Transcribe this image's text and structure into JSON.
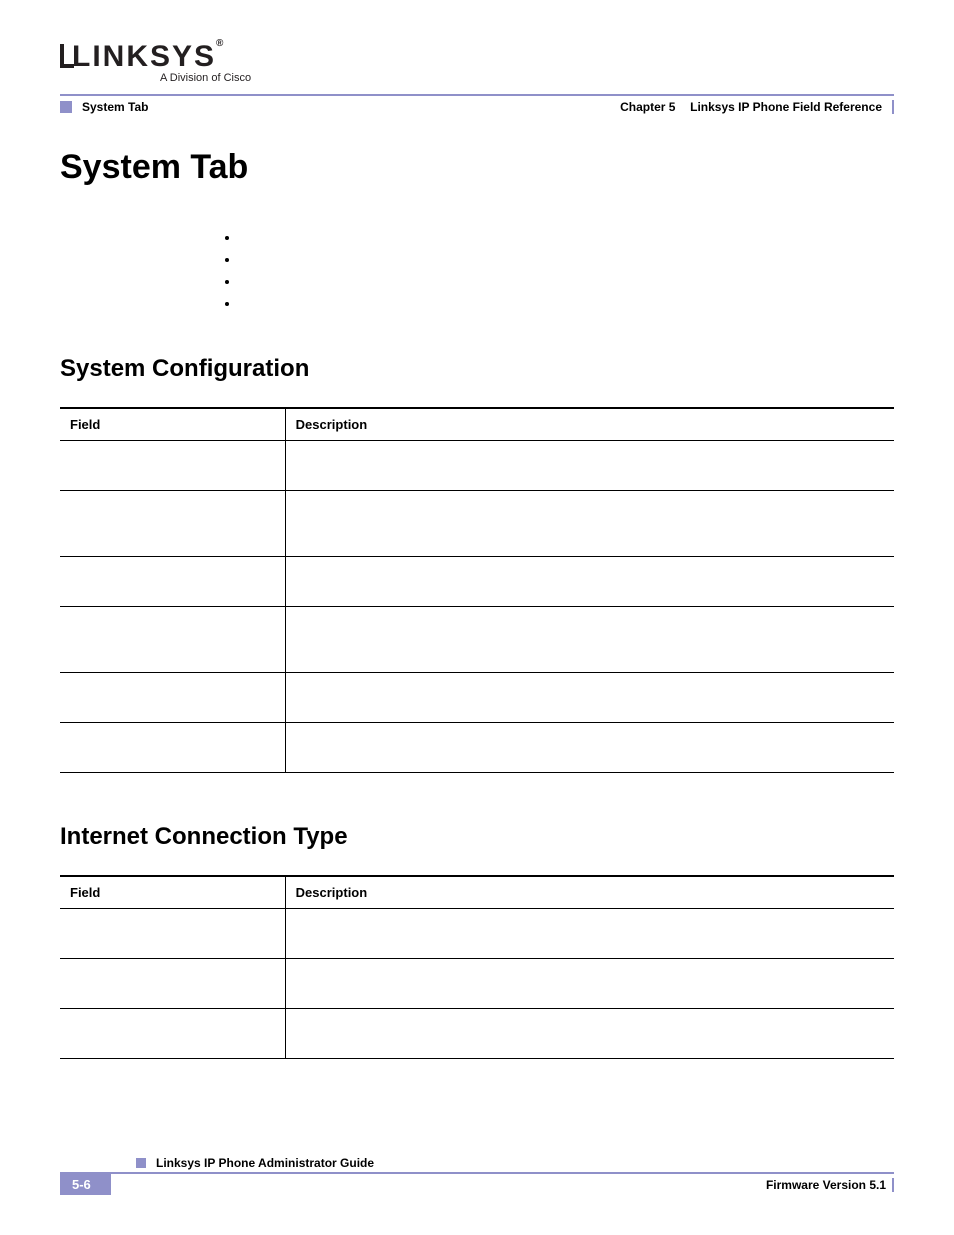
{
  "logo": {
    "brand": "LINKSYS",
    "registered": "®",
    "tagline": "A Division of Cisco"
  },
  "header": {
    "breadcrumb": "System Tab",
    "chapter_label": "Chapter 5",
    "chapter_title": "Linksys IP Phone Field Reference"
  },
  "h1": "System Tab",
  "bullets": [
    "",
    "",
    "",
    ""
  ],
  "section1": {
    "title": "System Configuration",
    "col_field": "Field",
    "col_desc": "Description",
    "rows": [
      {
        "field": "",
        "desc": ""
      },
      {
        "field": "",
        "desc": ""
      },
      {
        "field": "",
        "desc": ""
      },
      {
        "field": "",
        "desc": ""
      },
      {
        "field": "",
        "desc": ""
      },
      {
        "field": "",
        "desc": ""
      }
    ]
  },
  "section2": {
    "title": "Internet Connection Type",
    "col_field": "Field",
    "col_desc": "Description",
    "rows": [
      {
        "field": "",
        "desc": ""
      },
      {
        "field": "",
        "desc": ""
      },
      {
        "field": "",
        "desc": ""
      }
    ]
  },
  "footer": {
    "guide_title": "Linksys IP Phone Administrator Guide",
    "page_number": "5-6",
    "firmware": "Firmware Version 5.1"
  }
}
